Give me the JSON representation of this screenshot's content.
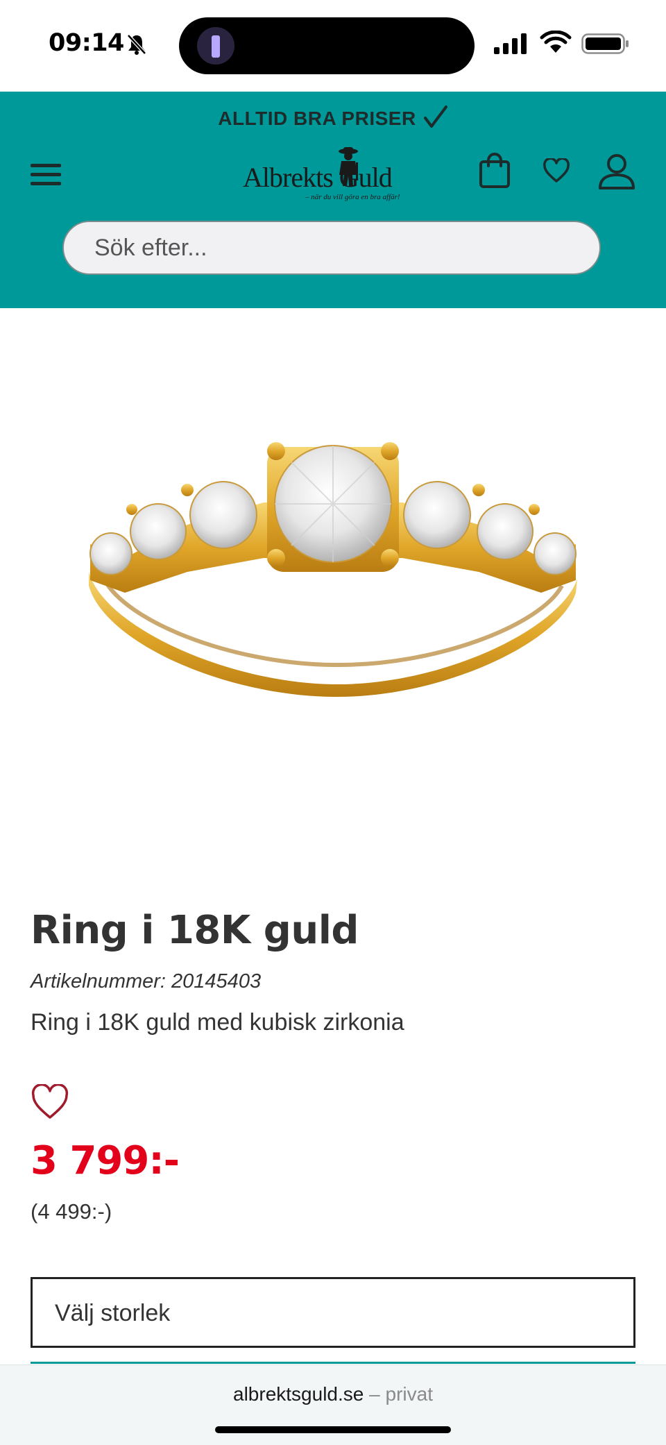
{
  "status_bar": {
    "time": "09:14",
    "icons": [
      "bell-muted-icon",
      "flashlight-icon",
      "signal-icon",
      "wifi-icon",
      "battery-icon"
    ]
  },
  "header": {
    "promo_text": "ALLTID BRA PRISER",
    "logo_text": "Albrekts Guld",
    "logo_tagline": "– när du vill göra en bra affär!",
    "icons": [
      "menu-icon",
      "cart-icon",
      "heart-icon",
      "user-icon"
    ],
    "search_placeholder": "Sök efter..."
  },
  "product": {
    "title": "Ring i 18K guld",
    "sku": "Artikelnummer: 20145403",
    "description": "Ring i 18K guld med kubisk zirkonia",
    "price": "3 799:-",
    "old_price": "(4 499:-)",
    "size_select_label": "Välj storlek"
  },
  "browser": {
    "domain": "albrektsguld.se",
    "separator": "–",
    "mode": "privat"
  },
  "colors": {
    "header_bg": "#00999a",
    "price_red": "#e3001b",
    "wishlist_red": "#a01c2c",
    "text_dark": "#333333"
  }
}
